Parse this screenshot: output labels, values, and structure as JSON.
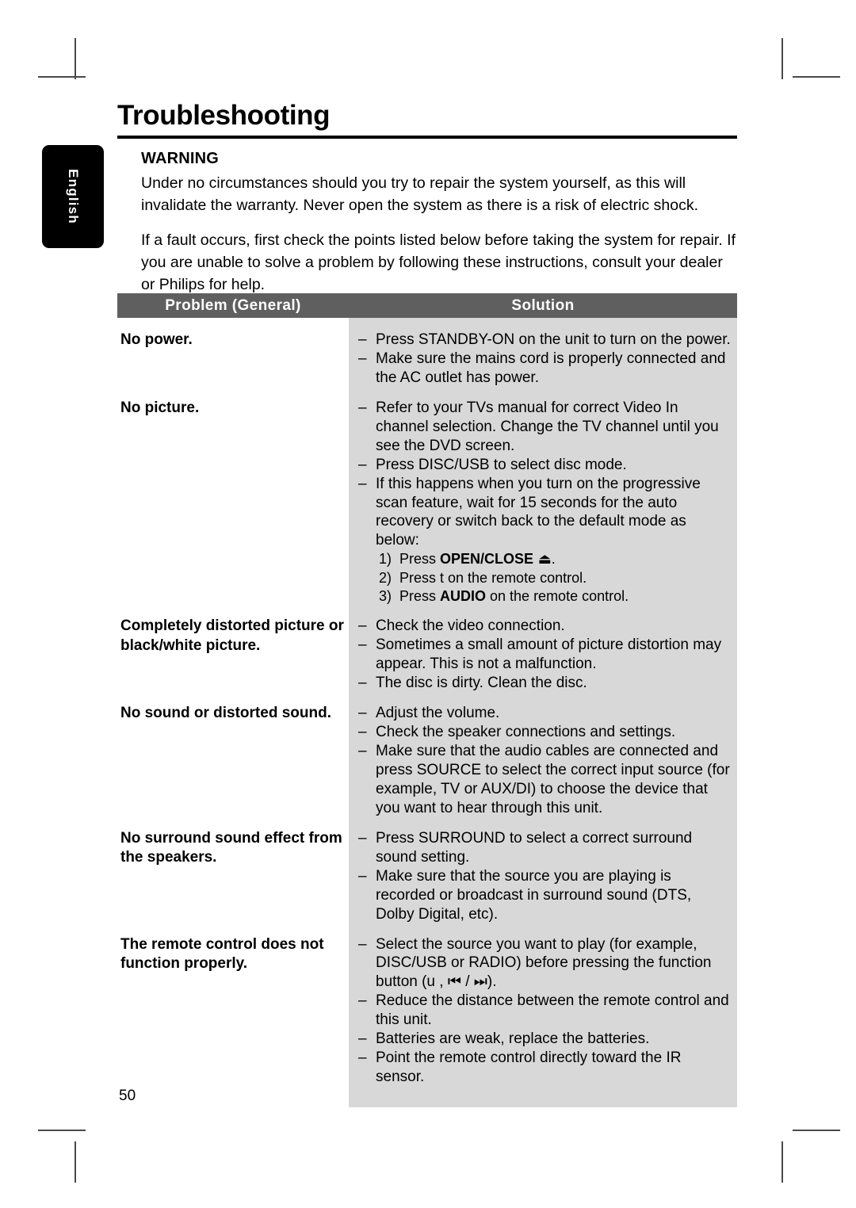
{
  "language_tab": {
    "label": "English"
  },
  "page_title": "Troubleshooting",
  "page_number": "50",
  "colors": {
    "table_header_bg": "#5f5f5f",
    "solution_column_bg": "#d8d8d8",
    "tab_bg": "#000000",
    "text": "#000000"
  },
  "warning": {
    "heading": "WARNING",
    "paragraphs": [
      "Under no circumstances should you try to repair the system yourself, as this will invalidate the warranty. Never open the system as there is a risk of electric shock.",
      "If a fault occurs, first check the points listed below before taking the system for repair. If you are unable to solve a problem by following these instructions, consult your dealer or Philips for help."
    ]
  },
  "table": {
    "headers": {
      "problem": "Problem (General)",
      "solution": "Solution"
    },
    "rows": [
      {
        "problem": "No power.",
        "solutions": [
          "Press STANDBY-ON on the unit to turn on the power.",
          "Make sure the mains cord is properly connected and the AC outlet has power."
        ]
      },
      {
        "problem": "No picture.",
        "solutions": [
          "Refer to your TVs manual for correct Video In channel selection. Change the TV channel until you see the DVD screen.",
          "Press DISC/USB to select disc mode.",
          "If this happens when you turn on the progressive scan feature, wait for 15 seconds for the auto recovery or switch back to the default mode as below:"
        ],
        "numbered": [
          {
            "num": "1)",
            "pre": "Press ",
            "bold": "OPEN/CLOSE",
            "symbol": "⏏",
            "post": "."
          },
          {
            "num": "2)",
            "pre": "Press t",
            "bold": "",
            "symbol": "",
            "post": " on the remote control."
          },
          {
            "num": "3)",
            "pre": "Press ",
            "bold": "AUDIO",
            "symbol": "",
            "post": " on the remote control."
          }
        ]
      },
      {
        "problem": "Completely distorted picture or black/white picture.",
        "solutions": [
          "Check the video connection.",
          "Sometimes a small amount of picture distortion may appear. This is not a malfunction.",
          "The disc is dirty. Clean the disc."
        ]
      },
      {
        "problem": "No sound or distorted sound.",
        "solutions": [
          "Adjust the volume.",
          "Check the speaker connections and settings.",
          "Make sure that the audio cables are connected and press SOURCE to select the correct input source (for example, TV or AUX/DI) to choose the device that you want to hear through this unit."
        ]
      },
      {
        "problem": "No surround sound effect from the speakers.",
        "solutions": [
          "Press SURROUND to select a correct surround sound setting.",
          "Make sure that the source you are playing is recorded or broadcast in surround sound (DTS, Dolby Digital, etc)."
        ]
      },
      {
        "problem": "The remote control does not function properly.",
        "solutions": [
          "Select the source you want to play (for example, DISC/USB or RADIO) before pressing the function button (u , ⏮ / ⏭).",
          "Reduce the distance between the remote control and this unit.",
          "Batteries are weak, replace the batteries.",
          "Point the remote control directly toward the IR sensor."
        ]
      }
    ],
    "bullet_marker": "–"
  }
}
